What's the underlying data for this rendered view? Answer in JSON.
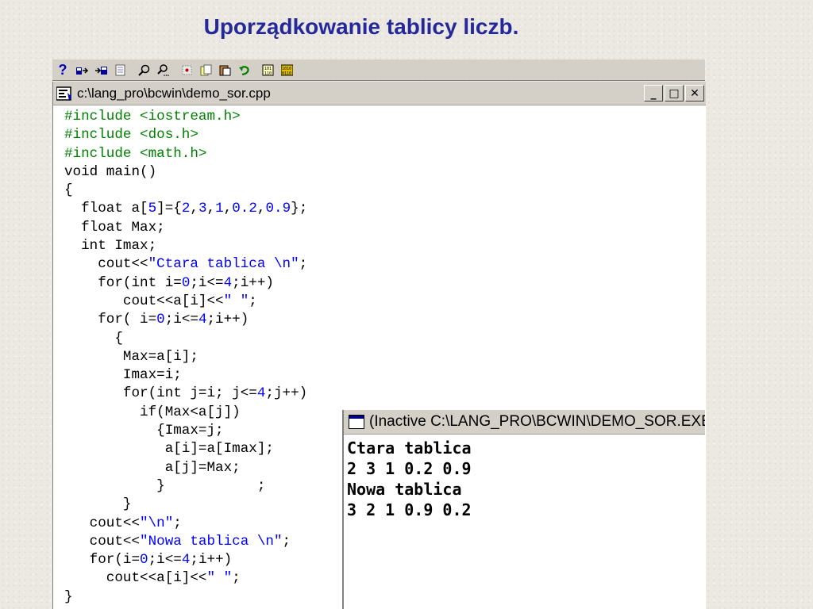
{
  "slide": {
    "title": "Uporządkowanie tablicy liczb."
  },
  "toolbar": {
    "buttons": [
      {
        "name": "help-icon",
        "label": "?"
      },
      {
        "name": "open-project-icon"
      },
      {
        "name": "save-project-icon"
      },
      {
        "name": "notes-icon"
      },
      {
        "name": "find-icon"
      },
      {
        "name": "find-next-icon"
      },
      {
        "name": "cut-icon"
      },
      {
        "name": "copy-icon"
      },
      {
        "name": "paste-icon"
      },
      {
        "name": "undo-icon"
      },
      {
        "name": "compile-icon"
      },
      {
        "name": "run-icon"
      }
    ]
  },
  "editor": {
    "title": "c:\\lang_pro\\bcwin\\demo_sor.cpp",
    "win_buttons": {
      "minimize": "_",
      "maximize": "□",
      "close": "✕"
    },
    "lines": [
      [
        {
          "t": "#include <iostream.h>",
          "c": "pp"
        }
      ],
      [
        {
          "t": "#include <dos.h>",
          "c": "pp"
        }
      ],
      [
        {
          "t": "#include <math.h>",
          "c": "pp"
        }
      ],
      [
        {
          "t": "void main()",
          "c": ""
        }
      ],
      [
        {
          "t": "{",
          "c": ""
        }
      ],
      [
        {
          "t": "  float a[",
          "c": ""
        },
        {
          "t": "5",
          "c": "num"
        },
        {
          "t": "]={",
          "c": ""
        },
        {
          "t": "2",
          "c": "num"
        },
        {
          "t": ",",
          "c": ""
        },
        {
          "t": "3",
          "c": "num"
        },
        {
          "t": ",",
          "c": ""
        },
        {
          "t": "1",
          "c": "num"
        },
        {
          "t": ",",
          "c": ""
        },
        {
          "t": "0.2",
          "c": "num"
        },
        {
          "t": ",",
          "c": ""
        },
        {
          "t": "0.9",
          "c": "num"
        },
        {
          "t": "};",
          "c": ""
        }
      ],
      [
        {
          "t": "  float Max;",
          "c": ""
        }
      ],
      [
        {
          "t": "  int Imax;",
          "c": ""
        }
      ],
      [
        {
          "t": "    cout<<",
          "c": ""
        },
        {
          "t": "\"Ctara tablica \\n\"",
          "c": "str"
        },
        {
          "t": ";",
          "c": ""
        }
      ],
      [
        {
          "t": "    for(int i=",
          "c": ""
        },
        {
          "t": "0",
          "c": "num"
        },
        {
          "t": ";i<=",
          "c": ""
        },
        {
          "t": "4",
          "c": "num"
        },
        {
          "t": ";i++)",
          "c": ""
        }
      ],
      [
        {
          "t": "       cout<<a[i]<<",
          "c": ""
        },
        {
          "t": "\" \"",
          "c": "str"
        },
        {
          "t": ";",
          "c": ""
        }
      ],
      [
        {
          "t": "    for( i=",
          "c": ""
        },
        {
          "t": "0",
          "c": "num"
        },
        {
          "t": ";i<=",
          "c": ""
        },
        {
          "t": "4",
          "c": "num"
        },
        {
          "t": ";i++)",
          "c": ""
        }
      ],
      [
        {
          "t": "      {",
          "c": ""
        }
      ],
      [
        {
          "t": "       Max=a[i];",
          "c": ""
        }
      ],
      [
        {
          "t": "       Imax=i;",
          "c": ""
        }
      ],
      [
        {
          "t": "       for(int j=i; j<=",
          "c": ""
        },
        {
          "t": "4",
          "c": "num"
        },
        {
          "t": ";j++)",
          "c": ""
        }
      ],
      [
        {
          "t": "         if(Max<a[j])",
          "c": ""
        }
      ],
      [
        {
          "t": "           {Imax=j;",
          "c": ""
        }
      ],
      [
        {
          "t": "            a[i]=a[Imax];",
          "c": ""
        }
      ],
      [
        {
          "t": "            a[j]=Max;",
          "c": ""
        }
      ],
      [
        {
          "t": "           }           ;",
          "c": ""
        }
      ],
      [
        {
          "t": "       }",
          "c": ""
        }
      ],
      [
        {
          "t": "   cout<<",
          "c": ""
        },
        {
          "t": "\"\\n\"",
          "c": "str"
        },
        {
          "t": ";",
          "c": ""
        }
      ],
      [
        {
          "t": "   cout<<",
          "c": ""
        },
        {
          "t": "\"Nowa tablica \\n\"",
          "c": "str"
        },
        {
          "t": ";",
          "c": ""
        }
      ],
      [
        {
          "t": "   for(i=",
          "c": ""
        },
        {
          "t": "0",
          "c": "num"
        },
        {
          "t": ";i<=",
          "c": ""
        },
        {
          "t": "4",
          "c": "num"
        },
        {
          "t": ";i++)",
          "c": ""
        }
      ],
      [
        {
          "t": "     cout<<a[i]<<",
          "c": ""
        },
        {
          "t": "\" \"",
          "c": "str"
        },
        {
          "t": ";",
          "c": ""
        }
      ],
      [
        {
          "t": "}",
          "c": ""
        }
      ]
    ]
  },
  "console": {
    "title": "(Inactive C:\\LANG_PRO\\BCWIN\\DEMO_SOR.EXE)",
    "output": [
      "Ctara tablica",
      "2 3 1 0.2 0.9",
      "Nowa tablica",
      "3 2 1 0.9 0.2"
    ]
  },
  "colors": {
    "title": "#24289a",
    "keyword_pp": "#008000",
    "literal": "#0000ff"
  }
}
